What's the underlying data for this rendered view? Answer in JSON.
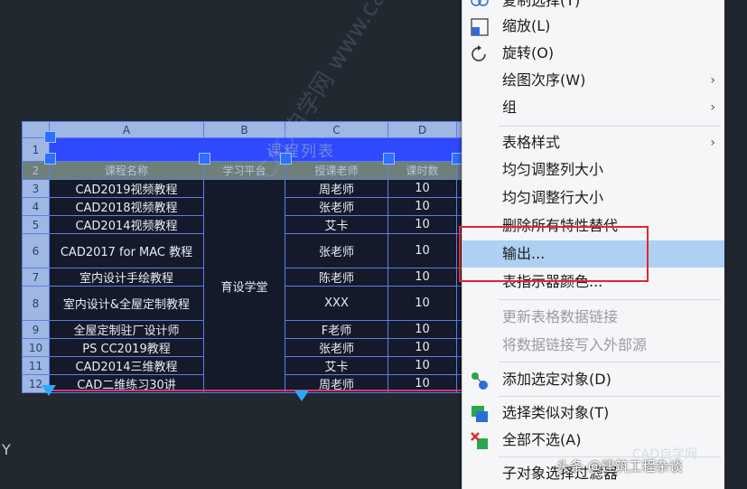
{
  "ucs_label": "Y",
  "table": {
    "column_letters": [
      "A",
      "B",
      "C",
      "D"
    ],
    "title": "课程列表",
    "col_headers": [
      "课程名称",
      "学习平台",
      "授课老师",
      "课时数"
    ],
    "platform": "育设学堂",
    "rows": [
      {
        "num": "3",
        "course": "CAD2019视频教程",
        "teacher": "周老师",
        "hours": "10"
      },
      {
        "num": "4",
        "course": "CAD2018视频教程",
        "teacher": "张老师",
        "hours": "10"
      },
      {
        "num": "5",
        "course": "CAD2014视频教程",
        "teacher": "艾卡",
        "hours": "10"
      },
      {
        "num": "6",
        "course": "CAD2017 for MAC 教程",
        "teacher": "张老师",
        "hours": "10"
      },
      {
        "num": "7",
        "course": "室内设计手绘教程",
        "teacher": "陈老师",
        "hours": "10"
      },
      {
        "num": "8",
        "course": "室内设计&全屋定制教程",
        "teacher": "XXX",
        "hours": "10"
      },
      {
        "num": "9",
        "course": "全屋定制驻厂设计师",
        "teacher": "F老师",
        "hours": "10"
      },
      {
        "num": "10",
        "course": "PS CC2019教程",
        "teacher": "张老师",
        "hours": "10"
      },
      {
        "num": "11",
        "course": "CAD2014三维教程",
        "teacher": "艾卡",
        "hours": "10"
      },
      {
        "num": "12",
        "course": "CAD二维练习30讲",
        "teacher": "周老师",
        "hours": "10"
      }
    ],
    "title_rownum": "1",
    "header_rownum": "2"
  },
  "watermark": "CAD自学网 www.cadzxw.com",
  "menu": {
    "items": [
      {
        "label": "复制选择(Y)",
        "state": "partial"
      },
      {
        "label": "缩放(L)",
        "icon": "scale-icon"
      },
      {
        "label": "旋转(O)",
        "icon": "rotate-icon"
      },
      {
        "label": "绘图次序(W)",
        "submenu": true
      },
      {
        "label": "组",
        "submenu": true
      },
      {
        "label": "表格样式",
        "submenu": true
      },
      {
        "label": "均匀调整列大小"
      },
      {
        "label": "均匀调整行大小"
      },
      {
        "label": "删除所有特性替代"
      },
      {
        "label": "输出...",
        "highlighted": true
      },
      {
        "label": "表指示器颜色..."
      },
      {
        "label": "更新表格数据链接",
        "disabled": true
      },
      {
        "label": "将数据链接写入外部源",
        "disabled": true
      },
      {
        "label": "添加选定对象(D)",
        "icon": "add-selected-icon"
      },
      {
        "label": "选择类似对象(T)",
        "icon": "select-similar-icon"
      },
      {
        "label": "全部不选(A)",
        "icon": "deselect-all-icon"
      },
      {
        "label": "子对象选择过滤器"
      }
    ],
    "submenu_arrow": "›"
  },
  "credits": {
    "site": "CAD自学网",
    "author": "头条 @建筑工程杂谈"
  },
  "colors": {
    "canvas": "#212830",
    "table_border": "#5d7fe6",
    "title_fill": "#2f49ff",
    "menu_highlight": "#aed0f2",
    "annotation_box": "#e3262d"
  }
}
